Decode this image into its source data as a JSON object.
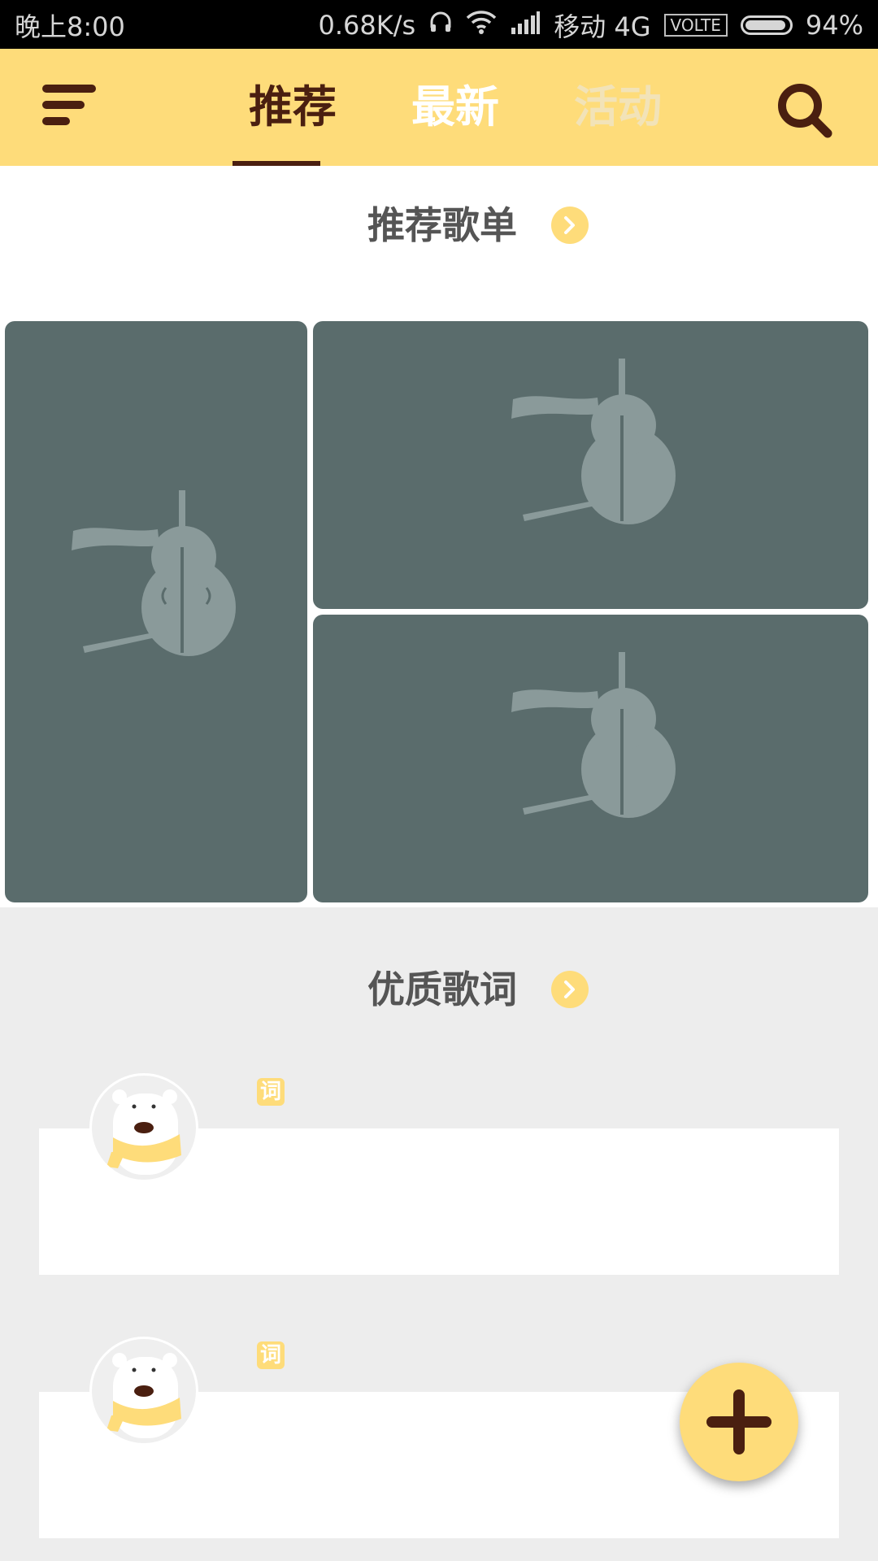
{
  "status_bar": {
    "time": "晚上8:00",
    "speed": "0.68K/s",
    "carrier": "移动 4G",
    "volte": "VOLTE",
    "battery": "94%",
    "battery_level": 0.94,
    "icons": [
      "headphones-icon",
      "wifi-icon",
      "signal-icon",
      "battery-icon"
    ]
  },
  "header": {
    "tabs": [
      {
        "label": "推荐",
        "state": "active"
      },
      {
        "label": "最新",
        "state": "normal"
      },
      {
        "label": "活动",
        "state": "faded"
      }
    ],
    "menu_icon": "menu-icon",
    "search_icon": "search-icon"
  },
  "recommended_playlists": {
    "title": "推荐歌单",
    "more_icon": "chevron-right-icon",
    "tiles": [
      "violin-placeholder",
      "violin-placeholder",
      "violin-placeholder"
    ]
  },
  "quality_lyrics": {
    "title": "优质歌词",
    "more_icon": "chevron-right-icon",
    "items": [
      {
        "badge": "词",
        "avatar": "polar-bear-avatar"
      },
      {
        "badge": "词",
        "avatar": "polar-bear-avatar"
      }
    ]
  },
  "fab": {
    "icon": "plus-icon"
  },
  "colors": {
    "accent": "#fedc7a",
    "dark_brown": "#4a1f10",
    "tile_bg": "#5a6c6c",
    "violin": "#8a9a9a",
    "page_bg": "#ededed"
  }
}
